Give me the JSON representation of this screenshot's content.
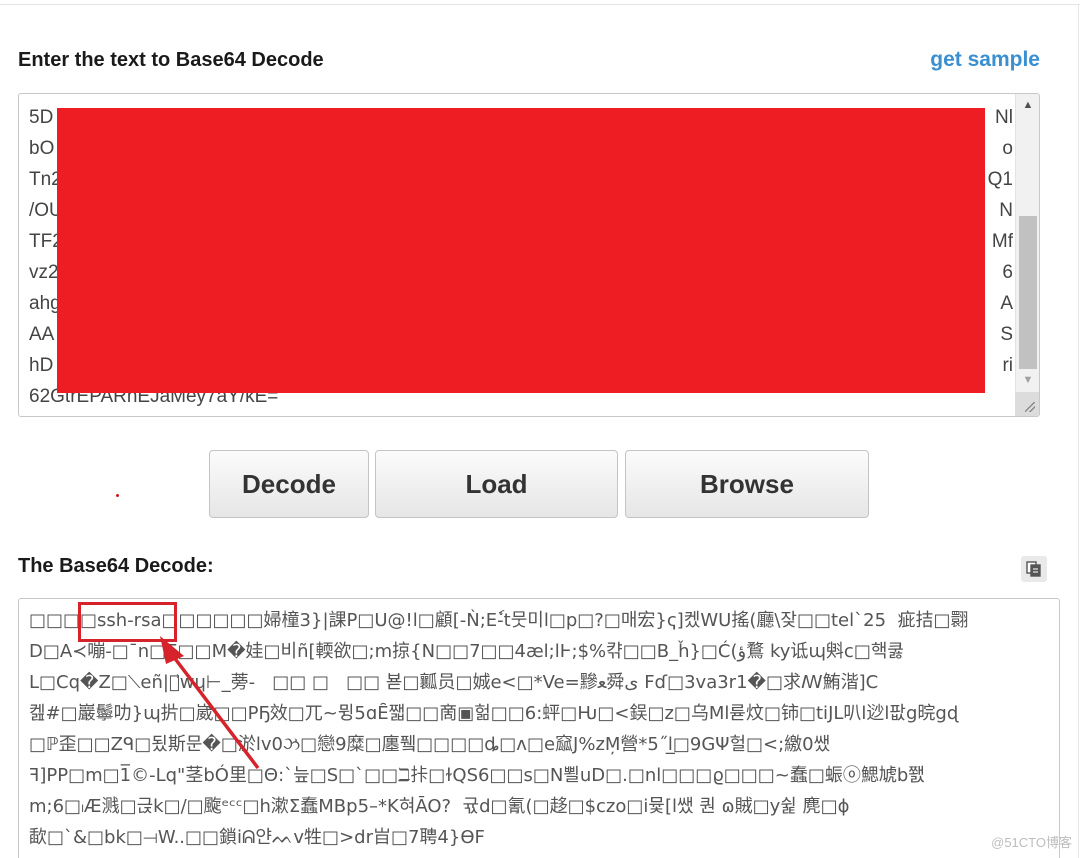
{
  "input_section": {
    "title": "Enter the text to Base64 Decode",
    "sample_link": "get sample",
    "visible_lines": [
      "5D",
      "bO",
      "Tn2",
      "/OU",
      "TF2",
      "vz2",
      "ahg",
      "AA",
      "hD",
      "62GtrEPARhEJaMey7aY/kE="
    ],
    "right_edge_fragments": [
      "Nl",
      "o",
      "Q1",
      "N",
      "Mf",
      "6",
      "A",
      "S",
      "ri",
      ""
    ]
  },
  "buttons": {
    "decode": "Decode",
    "load": "Load",
    "browse": "Browse"
  },
  "output_section": {
    "title": "The Base64 Decode:",
    "lines": [
      "□□□□ssh-rsa□□□□□□婦橦3}|課P□U@!l□顧[-Ǹ;Eٗ-t뭇미l□p□?□매宏}ҁ]켔WU搖(廳\\잦□□tel`25  疵拮□翾",
      "D□A≺嘣-□ˉn□E□□M�娃□비ñ[輭欲□;m掠{N□□7□□4æl;lͰ;$%캮□□B_ȟ}□Ć(ؤ鶩 ky诋ɰ斞c□핵쿯",
      "L□Cq�Z□⟍eñ|蘄⃗wɥ⊢_蒡-   □□ □   □□ 뵫□瓤员□娍e<□*Ve=黲ﻌ舜ی Fɗ□3va3r1�□求ꟿ鮪湝]C",
      "켎#□巖鬡叻}ɰ扸□崴□□PҔ效□兀~뮝5ɑȆ쨃□□啇▣헒□□6:蚲□Ƕ□<鋘□z□乌Ml륟炆□铈□tiJL叭l逤l팞g晥gɖ",
      "□ℙ歪□□Zᑫ□됬斯문�□淤lv0ઝ□戀9糜□廛퓈□□□□ȡ□ʌ□e窳J%zM̦營*5˝l̲□9GΨ헐□<;繳0쌨",
      "ꟻ]PP□m□1̅©-Lq\"茎bÓ里□Θ:`늪□S□`□□ℶ拤□ɫQS6□□s□N뾜uD□.□nl□□□ϱ□□□~蠢□蜄ⓞ鰓虓b쬀",
      "m;6□ₗÆ溅□귽k□/□颴ᵉᶜᶜ□h漱Ʃ蠢MBp5–*K혀ĀO?  귟d□氰(□趍□$czo□i뮻[l쌨 퀀 ɷ賊□y쉹 麂□ɸ",
      "歃□`&□bk□⟞W..□□鎖iᕱ얀ᨓv牲□>dr㞱□7聘4}ƟF"
    ],
    "highlighted": "ssh-rsa"
  },
  "watermark": "@51CTO博客",
  "colors": {
    "link": "#3a8fd0",
    "redaction": "#ee1d23",
    "annotation": "#d6232b"
  },
  "icons": {
    "copy": "copy-icon",
    "scroll_up": "scroll-up-arrow-icon",
    "scroll_down": "scroll-down-arrow-icon",
    "resize": "resize-grip-icon"
  }
}
